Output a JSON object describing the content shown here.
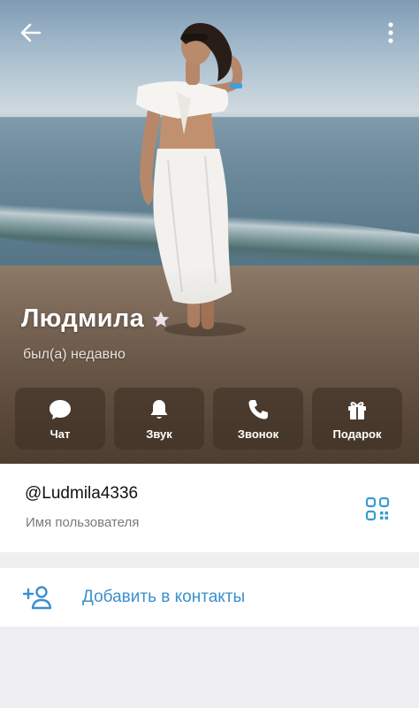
{
  "profile": {
    "name": "Людмила",
    "status": "был(а) недавно"
  },
  "actions": [
    {
      "label": "Чат",
      "icon": "chat-bubble-icon"
    },
    {
      "label": "Звук",
      "icon": "bell-icon"
    },
    {
      "label": "Звонок",
      "icon": "phone-icon"
    },
    {
      "label": "Подарок",
      "icon": "gift-icon"
    }
  ],
  "username_card": {
    "username": "@Ludmila4336",
    "caption": "Имя пользователя"
  },
  "add_contact": {
    "label": "Добавить в контакты"
  },
  "colors": {
    "accent": "#3a8fce",
    "background": "#efeff1"
  }
}
